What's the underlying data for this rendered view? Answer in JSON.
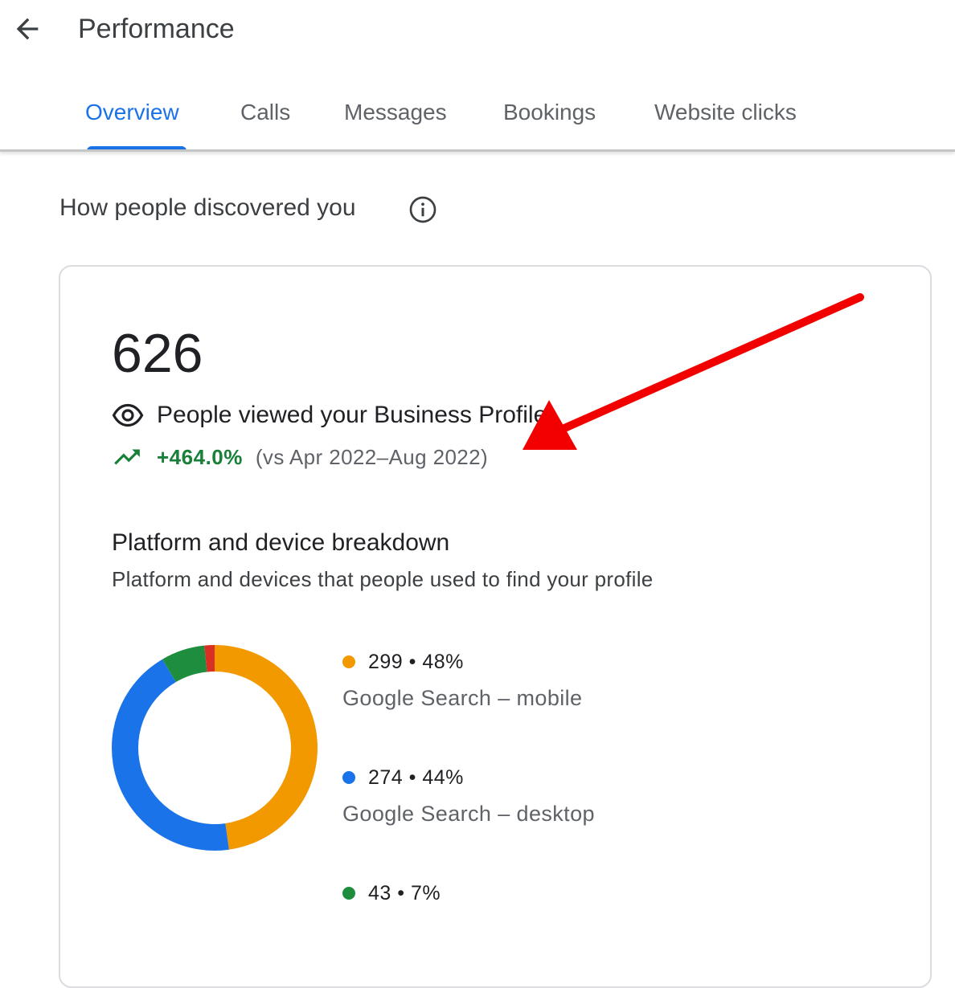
{
  "header": {
    "title": "Performance",
    "back_icon": "arrow-back-icon"
  },
  "tabs": [
    {
      "label": "Overview",
      "active": true
    },
    {
      "label": "Calls",
      "active": false
    },
    {
      "label": "Messages",
      "active": false
    },
    {
      "label": "Bookings",
      "active": false
    },
    {
      "label": "Website clicks",
      "active": false
    }
  ],
  "discovery": {
    "title": "How people discovered you",
    "info_icon": "info-icon"
  },
  "summary": {
    "total": "626",
    "views_label": "People viewed your Business Profile",
    "trend_value": "+464.0%",
    "trend_compare": "(vs Apr 2022–Aug 2022)"
  },
  "breakdown": {
    "title": "Platform and device breakdown",
    "subtitle": "Platform and devices that people used to find your profile",
    "items": [
      {
        "value_text": "299 • 48%",
        "label": "Google Search – mobile",
        "color": "#f29900"
      },
      {
        "value_text": "274 • 44%",
        "label": "Google Search – desktop",
        "color": "#1a73e8"
      },
      {
        "value_text": "43 • 7%",
        "label": "",
        "color": "#1e8e3e"
      }
    ]
  },
  "chart_data": {
    "type": "pie",
    "style": "donut",
    "categories": [
      "Google Search – mobile",
      "Google Search – desktop",
      "",
      ""
    ],
    "values": [
      299,
      274,
      43,
      10
    ],
    "colors": [
      "#f29900",
      "#1a73e8",
      "#1e8e3e",
      "#d93025"
    ]
  },
  "colors": {
    "accent": "#1a73e8",
    "trend_positive": "#188038",
    "annotation_arrow": "#f20000"
  }
}
